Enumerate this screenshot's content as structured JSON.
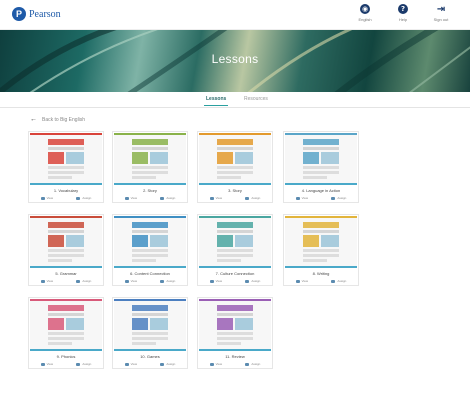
{
  "header": {
    "brand": "Pearson",
    "logo_letter": "P",
    "actions": [
      {
        "icon": "globe-icon",
        "glyph": "◉",
        "label": "English"
      },
      {
        "icon": "help-icon",
        "glyph": "?",
        "label": "Help"
      },
      {
        "icon": "sign-out-icon",
        "glyph": "⇥",
        "label": "Sign out"
      }
    ]
  },
  "hero": {
    "title": "Lessons"
  },
  "tabs": [
    {
      "label": "Lessons",
      "active": true
    },
    {
      "label": "Resources",
      "active": false
    }
  ],
  "back_link": {
    "label": "Back to Big English"
  },
  "card_actions": {
    "view_label": "View",
    "assign_label": "Assign"
  },
  "lessons": [
    {
      "title": "1. Vocabulary",
      "accent": "#d9443b"
    },
    {
      "title": "2. Story",
      "accent": "#8ab24a"
    },
    {
      "title": "3. Story",
      "accent": "#e39a2d"
    },
    {
      "title": "4. Language in Action",
      "accent": "#5aa5c8"
    },
    {
      "title": "5. Grammar",
      "accent": "#c94c3a"
    },
    {
      "title": "6. Content Connection",
      "accent": "#3f8fc3"
    },
    {
      "title": "7. Culture Connection",
      "accent": "#4aa6a0"
    },
    {
      "title": "8. Writing",
      "accent": "#e2b43b"
    },
    {
      "title": "9. Phonics",
      "accent": "#d85a7a"
    },
    {
      "title": "10. Games",
      "accent": "#4c7fc0"
    },
    {
      "title": "11. Review",
      "accent": "#9a5fb5"
    }
  ],
  "colors": {
    "brand_blue": "#1e5aa8",
    "tab_active": "#2a6a6a",
    "card_underline": "#4aa9c9"
  }
}
